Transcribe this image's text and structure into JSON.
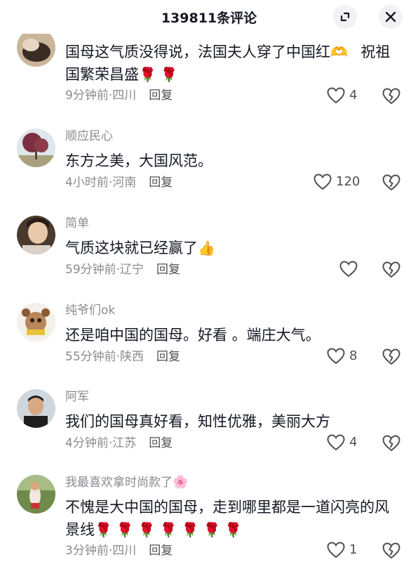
{
  "header": {
    "title": "139811条评论"
  },
  "comments": [
    {
      "username": "",
      "text": "国母这气质没得说，法国夫人穿了中国红",
      "emoji": "🫶 ",
      "text2": "祝祖国繁荣昌盛",
      "emoji2": "🌹🌹",
      "time": "9分钟前",
      "location": "四川",
      "reply": "回复",
      "likes": "4"
    },
    {
      "username": "顺应民心",
      "text": "东方之美，大国风范。",
      "time": "4小时前",
      "location": "河南",
      "reply": "回复",
      "likes": "120"
    },
    {
      "username": "简单",
      "text": "气质这块就已经赢了",
      "emoji": "👍",
      "time": "59分钟前",
      "location": "辽宁",
      "reply": "回复",
      "likes": ""
    },
    {
      "username": "纯爷们ok",
      "text": "还是咱中国的国母。好看 。端庄大气。",
      "time": "55分钟前",
      "location": "陕西",
      "reply": "回复",
      "likes": "8"
    },
    {
      "username": "阿军",
      "text": "我们的国母真好看，知性优雅，美丽大方",
      "time": "4分钟前",
      "location": "江苏",
      "reply": "回复",
      "likes": "4"
    },
    {
      "username": "我最喜欢拿时尚款了",
      "username_emoji": "🌸",
      "text": "不愧是大中国的国母，走到哪里都是一道闪亮的风景线",
      "emoji": "🌹🌹🌹🌹🌹🌹🌹",
      "time": "3分钟前",
      "location": "四川",
      "reply": "回复",
      "likes": "1"
    }
  ],
  "separator": "·",
  "icons": {
    "expand": "expand-icon",
    "close": "close-icon",
    "like": "heart-outline-icon",
    "dislike": "broken-heart-icon"
  },
  "colors": {
    "text": "#161823",
    "secondary": "#8a8b91",
    "reply": "#505156",
    "background": "#ffffff"
  }
}
